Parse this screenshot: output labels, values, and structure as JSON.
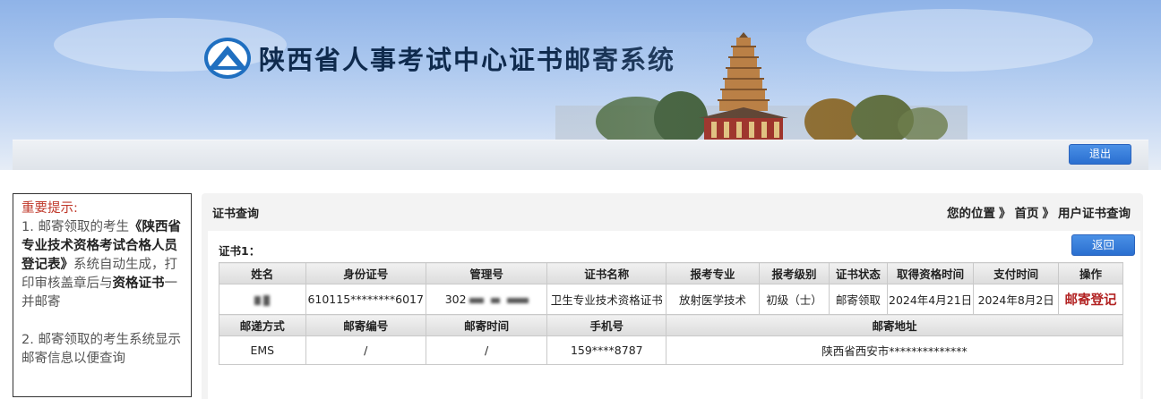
{
  "header": {
    "site_title": "陕西省人事考试中心证书邮寄系统",
    "logout_label": "退出"
  },
  "notice": {
    "title": "重要提示:",
    "item1": {
      "prefix": "1. 邮寄领取的考生",
      "form_name": "《陕西省专业技术资格考试合格人员登记表》",
      "middle": "系统自动生成，打印审核盖章后与",
      "cert_name": "资格证书",
      "suffix": "一并邮寄"
    },
    "item2": "2. 邮寄领取的考生系统显示邮寄信息以便查询"
  },
  "panel": {
    "title": "证书查询",
    "breadcrumb": {
      "prefix": "您的位置",
      "items": [
        "首页",
        "用户证书查询"
      ],
      "separator": "》"
    },
    "cert_label": "证书1：",
    "back_label": "返回"
  },
  "cert_table": {
    "headers": [
      "姓名",
      "身份证号",
      "管理号",
      "证书名称",
      "报考专业",
      "报考级别",
      "证书状态",
      "取得资格时间",
      "支付时间",
      "操作"
    ],
    "row": {
      "name": "",
      "id_number": "610115********6017",
      "mgmt_number": "302",
      "cert_name": "卫生专业技术资格证书",
      "major": "放射医学技术",
      "level": "初级（士）",
      "status": "邮寄领取",
      "qualified_date": "2024年4月21日",
      "pay_date": "2024年8月2日",
      "action": "邮寄登记"
    }
  },
  "mail_table": {
    "headers": [
      "邮递方式",
      "邮寄编号",
      "邮寄时间",
      "手机号",
      "邮寄地址"
    ],
    "row": {
      "method": "EMS",
      "number": "/",
      "time": "/",
      "phone": "159****8787",
      "address": "陕西省西安市**************"
    }
  },
  "colors": {
    "button_blue": "#2a6fd0",
    "notice_title": "#c0392b",
    "action_red": "#b22222",
    "title_navy": "#0f2a4d"
  }
}
